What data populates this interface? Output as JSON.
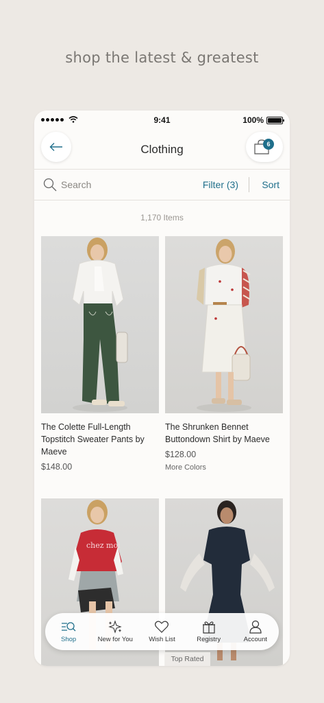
{
  "tagline": "shop the latest & greatest",
  "status_bar": {
    "time": "9:41",
    "battery": "100%"
  },
  "header": {
    "title": "Clothing",
    "cart_count": "6"
  },
  "toolbar": {
    "search_placeholder": "Search",
    "filter_label": "Filter (3)",
    "sort_label": "Sort"
  },
  "results": {
    "count": "1,170 Items"
  },
  "products": [
    {
      "name": "The Colette Full-Length Topstitch Sweater Pants by Maeve",
      "price": "$148.00",
      "extra": ""
    },
    {
      "name": "The Shrunken Bennet Buttondown Shirt by Maeve",
      "price": "$128.00",
      "extra": "More Colors"
    },
    {
      "name": "",
      "price": "",
      "extra": "",
      "sweater_text": "chez moi"
    },
    {
      "name": "",
      "price": "",
      "extra": "Top Rated"
    }
  ],
  "tabbar": {
    "shop": "Shop",
    "new_for_you": "New for You",
    "wish_list": "Wish List",
    "registry": "Registry",
    "account": "Account"
  },
  "colors": {
    "accent": "#1f6f8b",
    "background": "#ede9e4",
    "card": "#fcfbf9"
  }
}
